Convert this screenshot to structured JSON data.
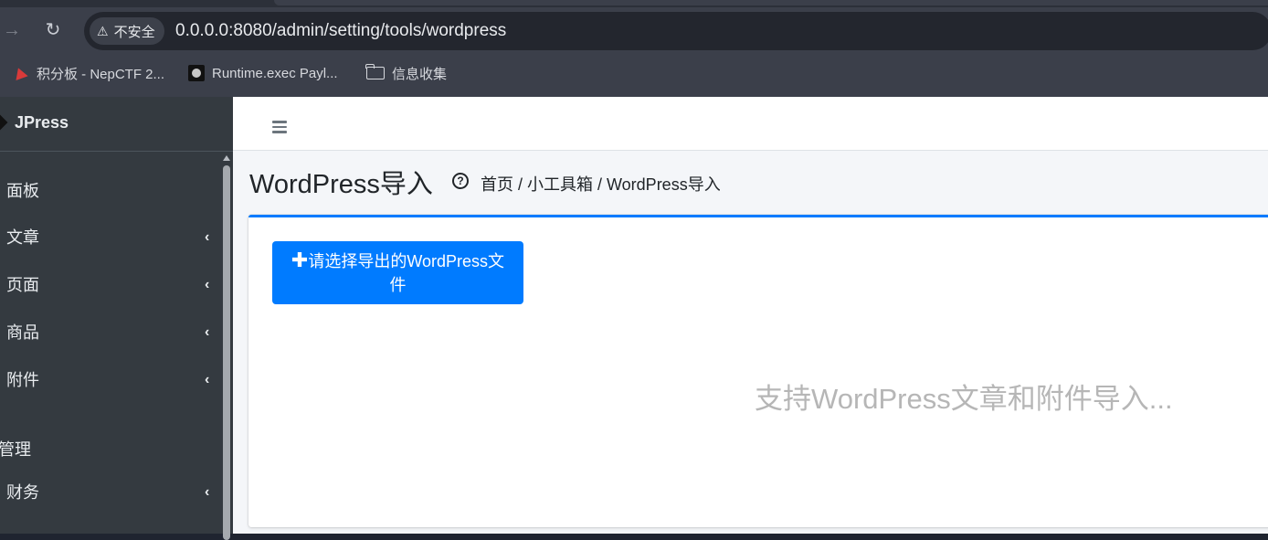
{
  "browser": {
    "security_label": "不安全",
    "url": "0.0.0.0:8080/admin/setting/tools/wordpress",
    "bookmarks": [
      {
        "label": "积分板 - NepCTF 2...",
        "icon": "nepctf-icon"
      },
      {
        "label": "Runtime.exec Payl...",
        "icon": "runtime-icon"
      },
      {
        "label": "信息收集",
        "icon": "folder-icon"
      }
    ]
  },
  "sidebar": {
    "brand": "JPress",
    "items": [
      {
        "label": "面板",
        "has_children": false
      },
      {
        "label": "文章",
        "has_children": true
      },
      {
        "label": "页面",
        "has_children": true
      },
      {
        "label": "商品",
        "has_children": true
      },
      {
        "label": "附件",
        "has_children": true
      }
    ],
    "section_header": "管理",
    "section_items": [
      {
        "label": "财务",
        "has_children": true
      }
    ],
    "chevron": "‹"
  },
  "main": {
    "title": "WordPress导入",
    "help_glyph": "?",
    "breadcrumb": "首页 / 小工具箱 / WordPress导入",
    "upload_button": {
      "icon": "plus-icon",
      "plus": "✚",
      "label": "请选择导出的WordPress文件"
    },
    "hint": "支持WordPress文章和附件导入..."
  },
  "colors": {
    "primary": "#007bff",
    "sidebar_bg": "#343a40",
    "content_bg": "#f4f6f9",
    "hint_text": "#b6b6b6"
  }
}
